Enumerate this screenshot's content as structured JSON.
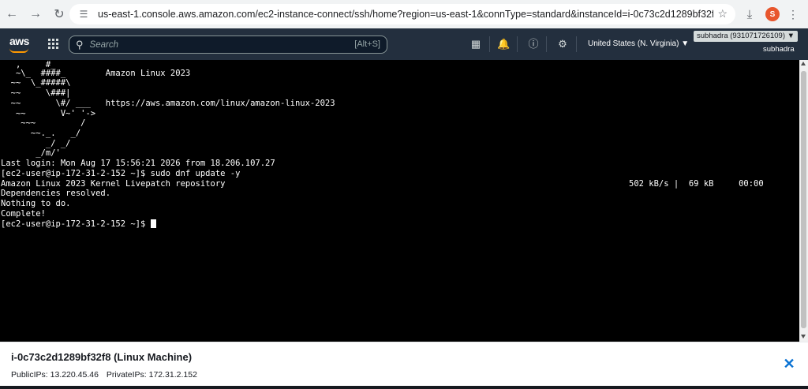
{
  "browser": {
    "url": "us-east-1.console.aws.amazon.com/ec2-instance-connect/ssh/home?region=us-east-1&connType=standard&instanceId=i-0c73c2d1289bf32f8&osUser=ec2-user&ssh...",
    "profile_initial": "S"
  },
  "aws_header": {
    "logo": "aws",
    "search_placeholder": "Search",
    "search_shortcut": "[Alt+S]",
    "region": "United States (N. Virginia) ▼",
    "account": "subhadra (931071726109) ▼",
    "username": "subhadra"
  },
  "terminal": {
    "lines": [
      "   ,     #_",
      "   ~\\_  ####_        Amazon Linux 2023",
      "  ~~  \\_#####\\",
      "  ~~     \\###|",
      "  ~~       \\#/ ___   https://aws.amazon.com/linux/amazon-linux-2023",
      "   ~~       V~' '->",
      "    ~~~         /",
      "      ~~._.   _/",
      "         _/ _/",
      "       _/m/'",
      "Last login: Mon Aug 17 15:56:21 2026 from 18.206.107.27",
      "[ec2-user@ip-172-31-2-152 ~]$ sudo dnf update -y",
      "Amazon Linux 2023 Kernel Livepatch repository",
      "Dependencies resolved.",
      "Nothing to do.",
      "Complete!",
      "[ec2-user@ip-172-31-2-152 ~]$ "
    ],
    "download_stats": "502 kB/s |  69 kB     00:00"
  },
  "instance_panel": {
    "title": "i-0c73c2d1289bf32f8 (Linux Machine)",
    "public_ips": "PublicIPs: 13.220.45.46",
    "private_ips": "PrivateIPs: 172.31.2.152"
  }
}
